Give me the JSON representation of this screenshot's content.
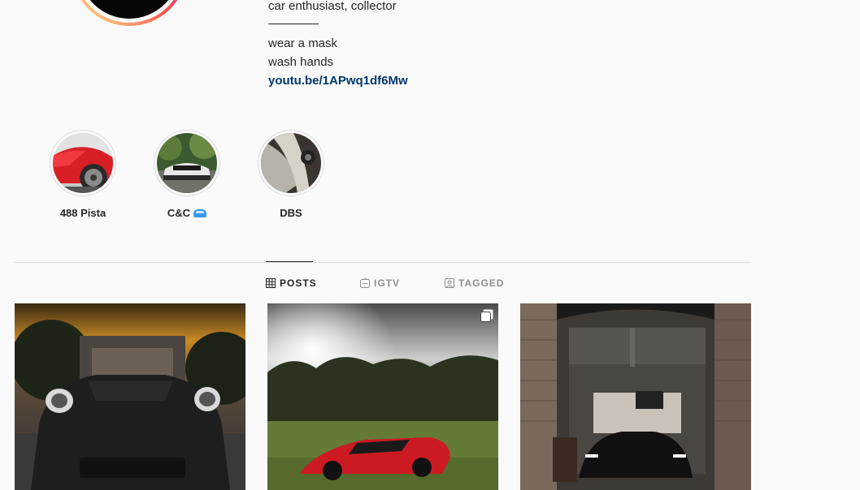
{
  "profile": {
    "bio_lines": [
      "car enthusiast, collector",
      "wear a mask",
      "wash hands"
    ],
    "link": "youtu.be/1APwq1df6Mw"
  },
  "highlights": [
    {
      "label": "488 Pista",
      "icon": "red-car-photo"
    },
    {
      "label": "C&C",
      "icon": "white-car-photo",
      "emoji": "car-emoji"
    },
    {
      "label": "DBS",
      "icon": "silver-car-photo"
    }
  ],
  "tabs": [
    {
      "label": "POSTS",
      "icon": "grid-icon",
      "active": true
    },
    {
      "label": "IGTV",
      "icon": "igtv-icon",
      "active": false
    },
    {
      "label": "TAGGED",
      "icon": "tagged-icon",
      "active": false
    }
  ],
  "posts": [
    {
      "subject": "black porsche photo"
    },
    {
      "subject": "red lamborghini photo",
      "icon": "multiple-photos-icon"
    },
    {
      "subject": "black car in garage photo"
    }
  ],
  "colors": {
    "background": "#fafafa",
    "text": "#262626",
    "muted": "#8e8e8e",
    "link": "#00376b",
    "border": "#dbdbdb"
  }
}
